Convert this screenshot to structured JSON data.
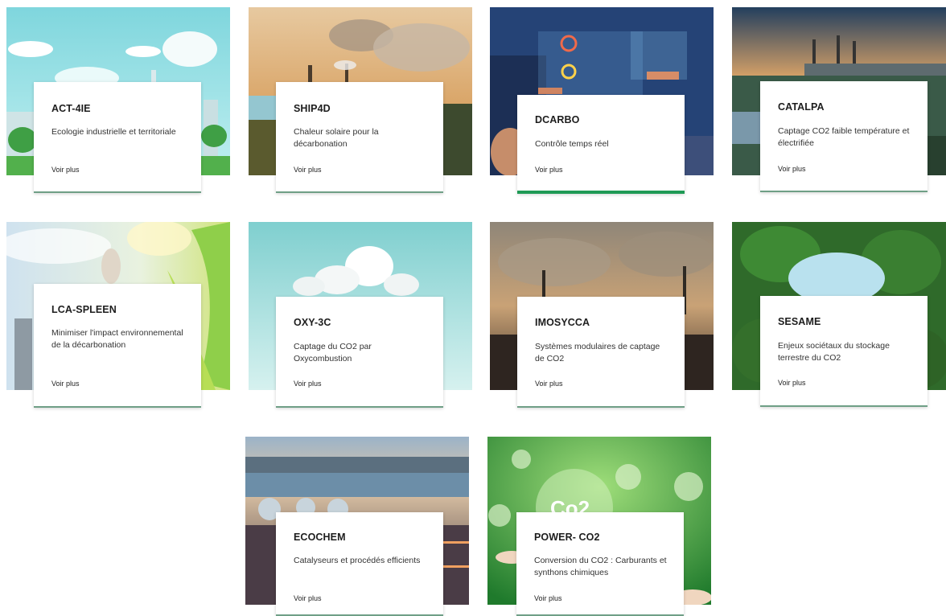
{
  "projects": [
    {
      "title": "ACT-4IE",
      "description": "Ecologie industrielle et territoriale",
      "link": "Voir plus"
    },
    {
      "title": "SHIP4D",
      "description": "Chaleur solaire pour la décarbonation",
      "link": "Voir plus"
    },
    {
      "title": "DCARBO",
      "description": "Contrôle temps réel",
      "link": "Voir plus"
    },
    {
      "title": "CATALPA",
      "description": "Captage CO2 faible température et électrifiée",
      "link": "Voir plus"
    },
    {
      "title": "LCA-SPLEEN",
      "description": "Minimiser l'impact environnemental de la décarbonation",
      "link": "Voir plus"
    },
    {
      "title": "OXY-3C",
      "description": "Captage du CO2 par Oxycombustion",
      "link": "Voir plus"
    },
    {
      "title": "IMOSYCCA",
      "description": "Systèmes modulaires de captage de CO2",
      "link": "Voir plus"
    },
    {
      "title": "SESAME",
      "description": "Enjeux sociétaux du stockage terrestre du CO2",
      "link": "Voir plus"
    },
    {
      "title": "ECOCHEM",
      "description": "Catalyseurs et procédés efficients",
      "link": "Voir plus"
    },
    {
      "title": "POWER- CO2",
      "description": "Conversion du CO2 : Carburants et synthons chimiques",
      "link": "Voir plus"
    }
  ],
  "image_text": {
    "co2_bubble": "Co2"
  },
  "colors": {
    "accent_green": "#1f9a55",
    "card_border": "#6f9f86"
  }
}
